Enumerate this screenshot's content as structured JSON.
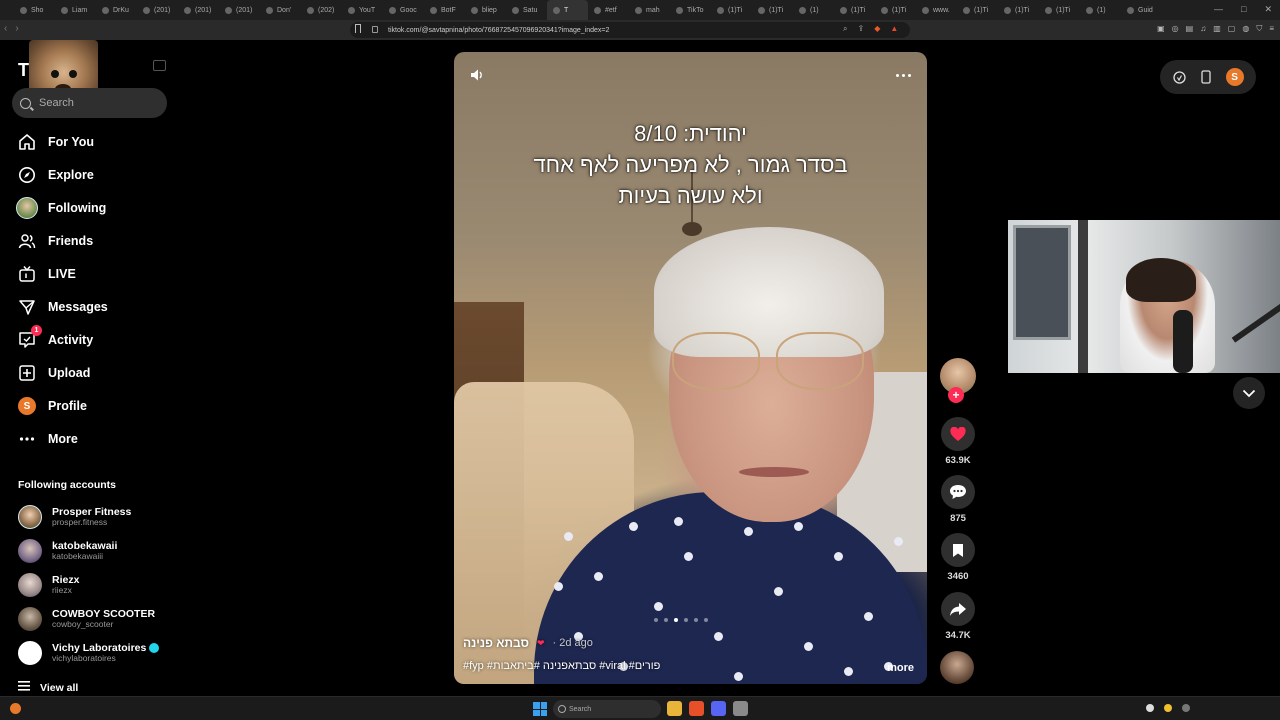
{
  "browser": {
    "tabs": [
      "Sho",
      "Liam",
      "DrKu",
      "(201)",
      "(201)",
      "(201)",
      "Don'",
      "(202)",
      "YouT",
      "Gooc",
      "BotF",
      "bliep",
      "Satu",
      "T",
      "#etf",
      "mah",
      "TikTo",
      "(1)Ti",
      "(1)Ti",
      "(1)",
      "(1)Ti",
      "(1)Ti",
      "www.",
      "(1)Ti",
      "(1)Ti",
      "(1)Ti",
      "(1)",
      "Guid"
    ],
    "active_tab_index": 13,
    "url": "tiktok.com/@savtapnina/photo/7668725457096920341?image_index=2",
    "window_controls": [
      "—",
      "□",
      "✕"
    ]
  },
  "sidebar": {
    "logo": "TikTok",
    "search_placeholder": "Search",
    "nav": [
      {
        "label": "For You",
        "icon": "home-icon"
      },
      {
        "label": "Explore",
        "icon": "compass-icon"
      },
      {
        "label": "Following",
        "icon": "following-avatar-icon"
      },
      {
        "label": "Friends",
        "icon": "friends-icon"
      },
      {
        "label": "LIVE",
        "icon": "live-icon"
      },
      {
        "label": "Messages",
        "icon": "messages-icon"
      },
      {
        "label": "Activity",
        "icon": "activity-icon",
        "badge": "1"
      },
      {
        "label": "Upload",
        "icon": "upload-icon"
      },
      {
        "label": "Profile",
        "icon": "profile-avatar-icon",
        "avatar_letter": "S"
      },
      {
        "label": "More",
        "icon": "more-icon"
      }
    ],
    "following_title": "Following accounts",
    "accounts": [
      {
        "name": "Prosper Fitness",
        "username": "prosper.fitness",
        "verified": false
      },
      {
        "name": "katobekawaii",
        "username": "katobekawaiii",
        "verified": false
      },
      {
        "name": "Riezx",
        "username": "riiezx",
        "verified": false
      },
      {
        "name": "COWBOY SCOOTER",
        "username": "cowboy_scooter",
        "verified": false
      },
      {
        "name": "Vichy Laboratoires",
        "username": "vichylaboratoires",
        "verified": true
      }
    ],
    "view_all": "View all"
  },
  "post": {
    "caption_line1": "יהודית: 8/10",
    "caption_line2": "בסדר גמור , לא מפריעה לאף אחד",
    "caption_line3": "ולא עושה בעיות",
    "author": "סבתא פנינה",
    "posted_ago": "2d ago",
    "hashtags": "#fyp #סבתאפנינה #ביתאבות #viral #פורים",
    "more_label": "more",
    "likes": "63.9K",
    "comments": "875",
    "saves": "3460",
    "shares": "34.7K"
  },
  "header_right": {
    "user_letter": "S"
  },
  "taskbar": {
    "search_placeholder": "Search"
  },
  "colors": {
    "accent": "#fe2c55",
    "profile": "#e8782a",
    "verified": "#20d5ec"
  }
}
